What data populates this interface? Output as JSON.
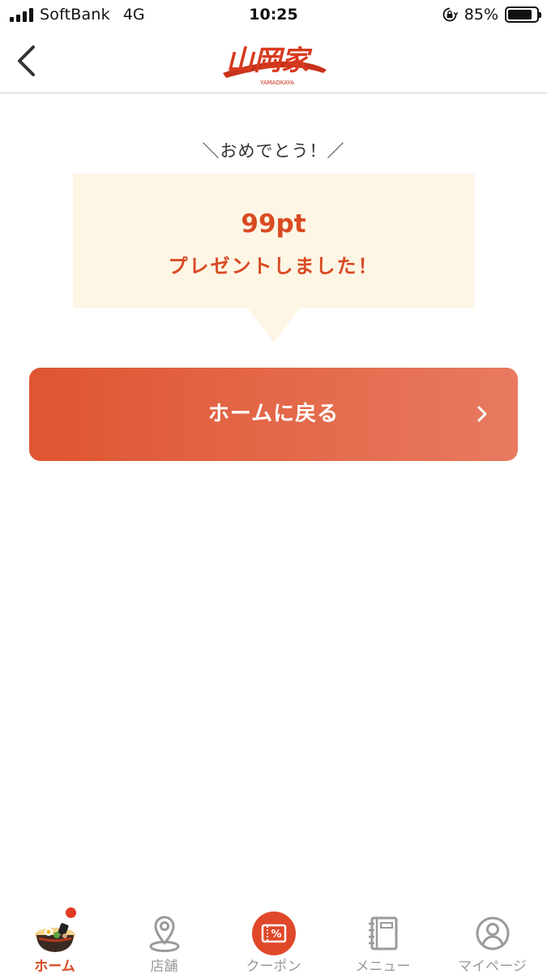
{
  "status_bar": {
    "carrier": "SoftBank",
    "network": "4G",
    "time": "10:25",
    "battery_percent": "85%",
    "battery_level": 0.85
  },
  "nav": {
    "logo_text": "山岡家",
    "logo_sub": "YAMAOKAYA"
  },
  "content": {
    "congrats": "＼おめでとう！／",
    "points": "99pt",
    "message": "プレゼントしました！",
    "home_button_label": "ホームに戻る"
  },
  "tabs": [
    {
      "label": "ホーム",
      "icon": "ramen-bowl-icon",
      "active": true
    },
    {
      "label": "店舗",
      "icon": "map-pin-icon",
      "active": false
    },
    {
      "label": "クーポン",
      "icon": "coupon-icon",
      "active": false
    },
    {
      "label": "メニュー",
      "icon": "menu-book-icon",
      "active": false
    },
    {
      "label": "マイページ",
      "icon": "user-icon",
      "active": false
    }
  ],
  "colors": {
    "accent": "#d94a22",
    "bubble_bg": "#fdf6e5",
    "button_gradient_start": "#de5531",
    "button_gradient_end": "#e87a60",
    "inactive_tab": "#9a9a9a"
  }
}
